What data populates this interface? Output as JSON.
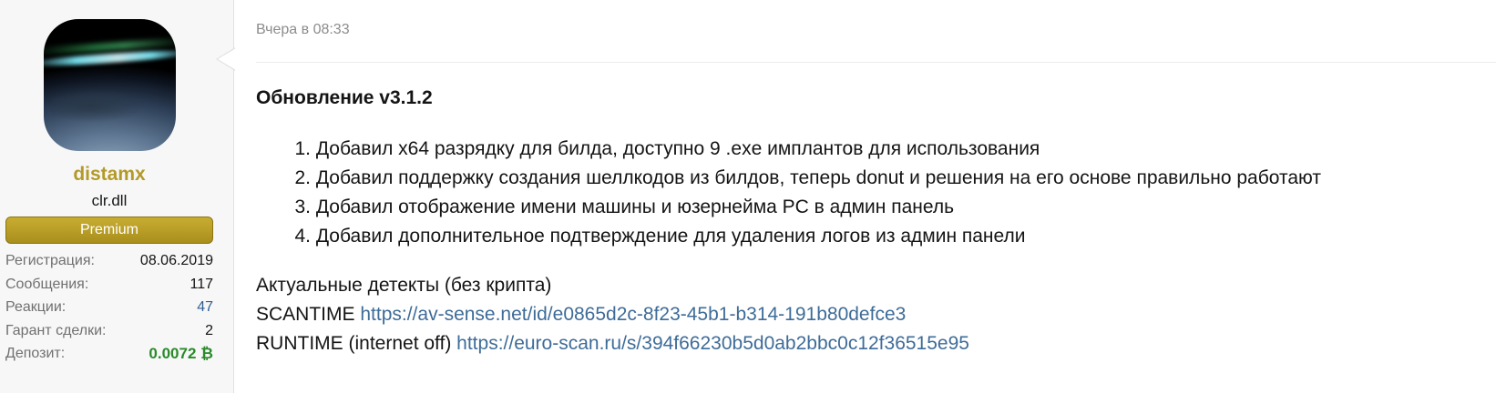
{
  "user": {
    "avatar_icon": "avatar-earth-horizon-icon",
    "name": "distamx",
    "title": "clr.dll",
    "badge": "Premium",
    "stats": [
      {
        "label": "Регистрация:",
        "value": "08.06.2019"
      },
      {
        "label": "Сообщения:",
        "value": "117"
      },
      {
        "label": "Реакции:",
        "value": "47"
      },
      {
        "label": "Гарант сделки:",
        "value": "2"
      },
      {
        "label": "Депозит:",
        "value": "0.0072 ₿"
      }
    ]
  },
  "post": {
    "date": "Вчера в 08:33",
    "heading": "Обновление v3.1.2",
    "changes": [
      {
        "num": "1.",
        "text": "Добавил x64 разрядку для билда, доступно 9 .exe имплантов для использования"
      },
      {
        "num": "2.",
        "text": "Добавил поддержку создания шеллкодов из билдов, теперь donut и решения на его основе правильно работают"
      },
      {
        "num": "3.",
        "text": "Добавил отображение имени машины и юзернейма PC в админ панель"
      },
      {
        "num": "4.",
        "text": "Добавил дополнительное подтверждение для удаления логов из админ панели"
      }
    ],
    "detects_title": "Актуальные детекты (без крипта)",
    "scantime_label": "SCANTIME",
    "scantime_link": "https://av-sense.net/id/e0865d2c-8f23-45b1-b314-191b80defce3",
    "runtime_label": "RUNTIME (internet off)",
    "runtime_link": "https://euro-scan.ru/s/394f66230b5d0ab2bbc0c12f36515e95"
  },
  "colors": {
    "username": "#b39a28",
    "badge": "#b89f28",
    "link": "#3e6c98",
    "deposit": "#2a8a2a"
  }
}
